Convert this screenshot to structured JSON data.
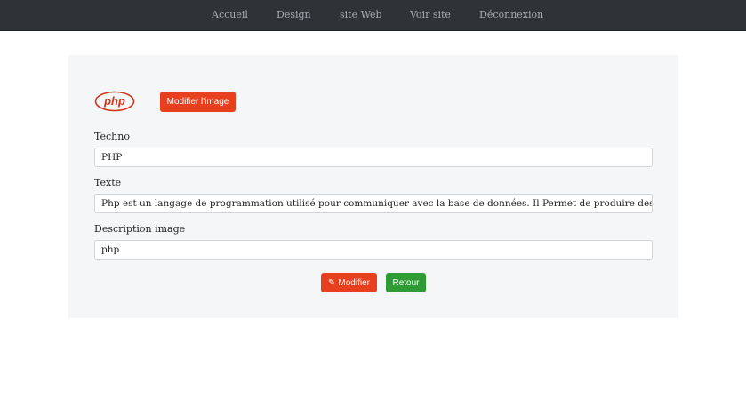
{
  "nav": {
    "items": [
      {
        "label": "Accueil"
      },
      {
        "label": "Design"
      },
      {
        "label": "site Web"
      },
      {
        "label": "Voir site"
      },
      {
        "label": "Déconnexion"
      }
    ]
  },
  "logo": {
    "text": "php",
    "color": "#d1331a"
  },
  "image_button": {
    "label": "Modifier l'image"
  },
  "form": {
    "techno": {
      "label": "Techno",
      "value": "PHP"
    },
    "texte": {
      "label": "Texte",
      "value": "Php est un langage de programmation utilisé pour communiquer avec la base de données. Il Permet de produire des sites web adm"
    },
    "description": {
      "label": "Description image",
      "value": "php"
    }
  },
  "actions": {
    "modify": {
      "label": "Modifier",
      "icon": "pencil-icon"
    },
    "back": {
      "label": "Retour"
    }
  },
  "colors": {
    "accent": "#e8401f",
    "success": "#2e9b34",
    "navbar": "#2f3337"
  }
}
